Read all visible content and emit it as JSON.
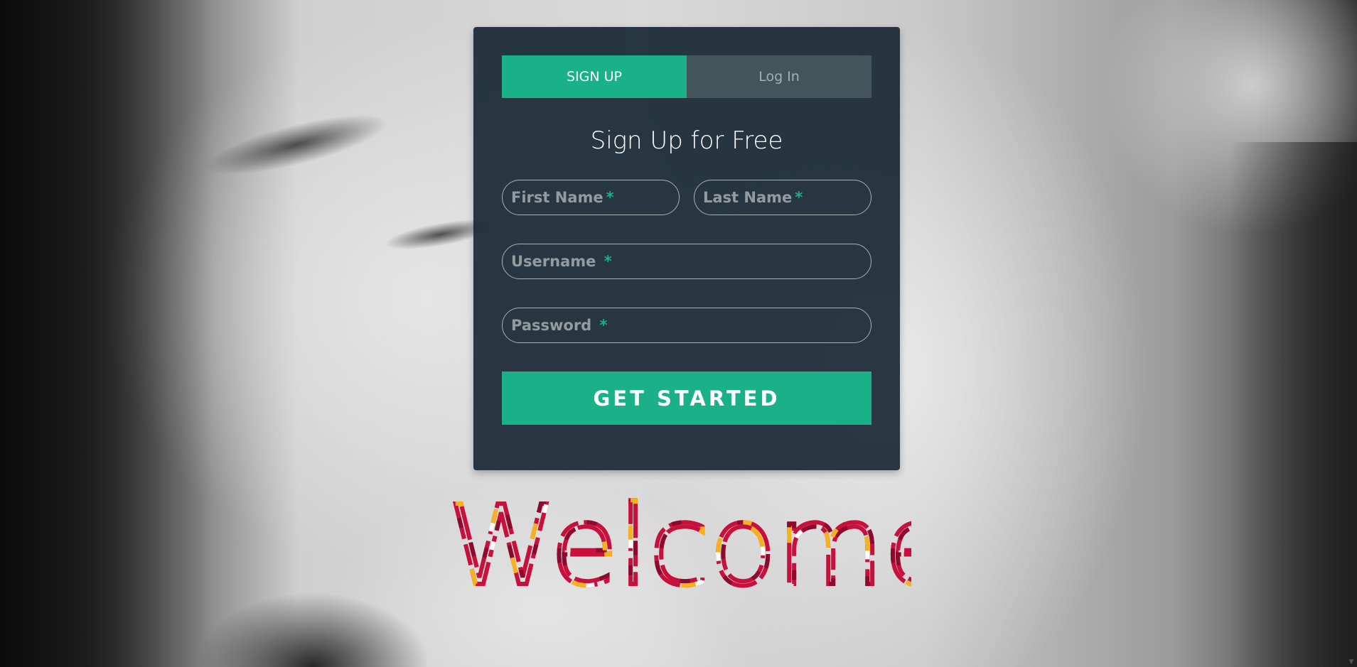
{
  "tabs": [
    {
      "label": "SIGN UP",
      "active": true
    },
    {
      "label": "Log In",
      "active": false
    }
  ],
  "form": {
    "heading": "Sign Up for Free",
    "first_name_placeholder": "First Name",
    "last_name_placeholder": "Last Name",
    "username_placeholder": "Username",
    "password_placeholder": "Password",
    "required_marker": "*",
    "submit_label": "GET STARTED"
  },
  "welcome": {
    "text": "Welcome",
    "colors": [
      "#c8103c",
      "#8b0a2e",
      "#f5b21d",
      "#ffffff"
    ]
  },
  "theme": {
    "accent": "#1ab188",
    "card_bg": "#13232f",
    "muted": "#a0b3b0"
  }
}
